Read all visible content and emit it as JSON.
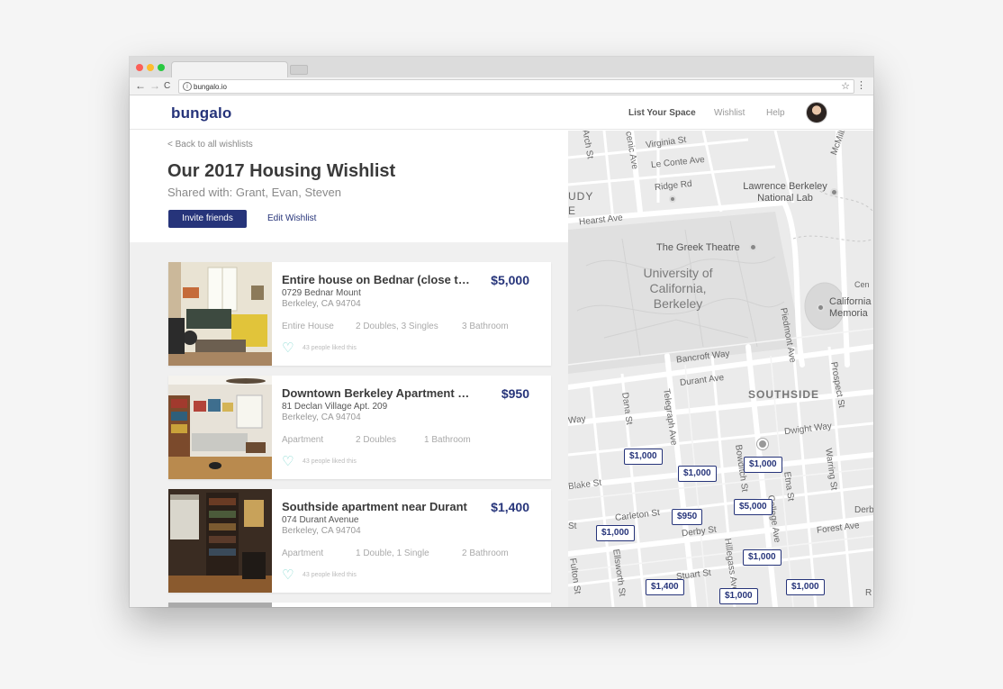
{
  "browser": {
    "url": "bungalo.io",
    "back_glyph": "←",
    "forward_glyph": "→",
    "reload_glyph": "C",
    "info_glyph": "i",
    "star_glyph": "☆",
    "menu_glyph": "⋮"
  },
  "header": {
    "logo": "bungalo",
    "nav": {
      "list_space": "List Your Space",
      "wishlist": "Wishlist",
      "help": "Help"
    }
  },
  "wishlist": {
    "back_link": "< Back to all wishlists",
    "title": "Our 2017 Housing Wishlist",
    "shared_with": "Shared with: Grant, Evan, Steven",
    "invite_label": "Invite friends",
    "edit_label": "Edit Wishlist"
  },
  "listings": [
    {
      "title": "Entire house on Bednar (close to campus)",
      "price": "$5,000",
      "address_line1": "0729 Bednar Mount",
      "address_line2": "Berkeley, CA 94704",
      "type": "Entire House",
      "beds": "2 Doubles, 3 Singles",
      "baths": "3 Bathroom",
      "liked": "43 people liked this",
      "heart": "♡"
    },
    {
      "title": "Downtown Berkeley Apartment near BART",
      "price": "$950",
      "address_line1": "81 Declan Village Apt. 209",
      "address_line2": "Berkeley, CA 94704",
      "type": "Apartment",
      "beds": "2 Doubles",
      "baths": "1 Bathroom",
      "liked": "43 people liked this",
      "heart": "♡"
    },
    {
      "title": "Southside apartment near Durant",
      "price": "$1,400",
      "address_line1": "074 Durant Avenue",
      "address_line2": "Berkeley, CA 94704",
      "type": "Apartment",
      "beds": "1 Double, 1 Single",
      "baths": "2 Bathroom",
      "liked": "43 people liked this",
      "heart": "♡"
    }
  ],
  "map": {
    "streets": {
      "arch": "Arch St",
      "virginia": "Virginia St",
      "scenic": "cenic Ave",
      "leconte": "Le Conte Ave",
      "mcmillan": "McMillan R",
      "ridge": "Ridge Rd",
      "udy": "UDY",
      "e_frag": "E",
      "hearst": "Hearst Ave",
      "piedmont": "Piedmont Ave",
      "bancroft": "Bancroft Way",
      "durant": "Durant Ave",
      "prospect": "Prospect St",
      "way": "Way",
      "dana": "Dana St",
      "telegraph": "Telegraph Ave",
      "dwight": "Dwight Way",
      "bowditch": "Bowditch St",
      "etna": "Etna St",
      "warring": "Warring St",
      "blake": "Blake St",
      "carleton": "Carleton St",
      "st_frag": "St",
      "derby": "Derby St",
      "derb": "Derb",
      "forest": "Forest Ave",
      "hillegass": "Hillegass Ave",
      "college": "College Ave",
      "stuart": "Stuart St",
      "fulton": "Fulton St",
      "ellsworth": "Ellsworth St",
      "r_frag": "R",
      "cen": "Cen"
    },
    "labels": {
      "lawrence": "Lawrence Berkeley National Lab",
      "greek": "The Greek Theatre",
      "university": "University of California, Berkeley",
      "california_memorial": "California Memoria",
      "southside": "SOUTHSIDE"
    },
    "pins": [
      "$1,000",
      "$1,000",
      "$1,000",
      "$5,000",
      "$950",
      "$1,000",
      "$1,000",
      "$1,400",
      "$1,000",
      "$1,000"
    ]
  }
}
